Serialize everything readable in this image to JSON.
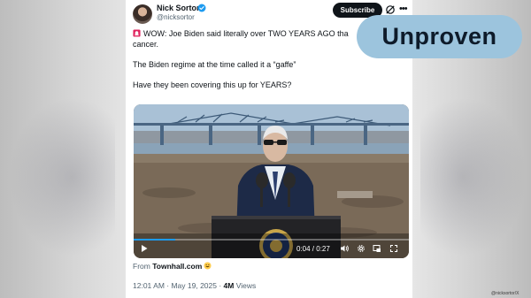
{
  "tweet": {
    "author_name": "Nick Sortor",
    "handle": "@nicksortor",
    "subscribe_label": "Subscribe",
    "lines": [
      "WOW: Joe Biden said literally over TWO YEARS AGO tha",
      "cancer.",
      "",
      "The Biden regime at the time called it a “gaffe”",
      "",
      "Have they been covering this up for YEARS?"
    ],
    "video": {
      "time": "0:04 / 0:27",
      "progress": 0.15
    },
    "from_prefix": "From",
    "from_source": "Townhall.com",
    "timestamp": "12:01 AM · May 19, 2025 ·",
    "views_count": "4M",
    "views_label": "Views"
  },
  "label": "Unproven",
  "credit": "@nicksortor/X",
  "colors": {
    "label_bg": "#9cc4dd",
    "verified": "#1d9bf0",
    "text_primary": "#0f1419",
    "text_secondary": "#536471"
  },
  "icons": [
    "verified-icon",
    "grok-icon",
    "more-icon",
    "siren-icon",
    "play-icon",
    "volume-icon",
    "settings-icon",
    "pip-icon",
    "fullscreen-icon",
    "grin-emoji"
  ]
}
